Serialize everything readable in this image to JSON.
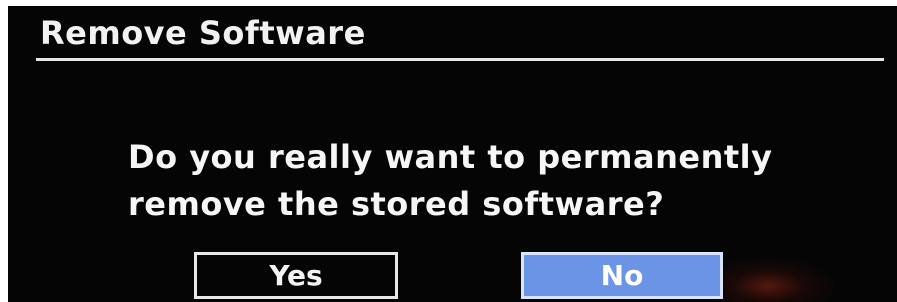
{
  "dialog": {
    "title": "Remove Software",
    "message_lines": [
      "Do you really want to permanently",
      "remove the stored software?"
    ],
    "buttons": {
      "yes_label": "Yes",
      "no_label": "No"
    },
    "selected_button": "No"
  },
  "colors": {
    "background": "#050506",
    "text": "#f4f4f4",
    "selected_button": "#6b93e6",
    "divider": "#e6e6e6"
  }
}
